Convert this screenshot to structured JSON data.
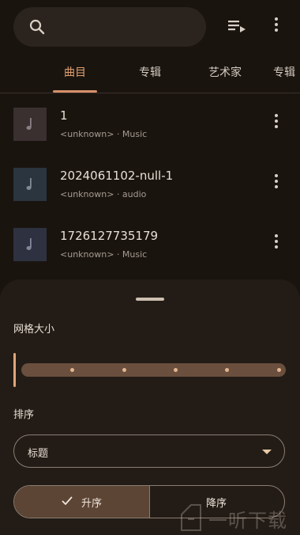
{
  "tabs": [
    {
      "label": "曲目"
    },
    {
      "label": "专辑"
    },
    {
      "label": "艺术家"
    },
    {
      "label": "专辑"
    }
  ],
  "songs": [
    {
      "title": "1",
      "subtitle": "<unknown> · Music",
      "thumb_color": "#3a3030"
    },
    {
      "title": "2024061102-null-1",
      "subtitle": "<unknown> · audio",
      "thumb_color": "#2a3540"
    },
    {
      "title": "1726127735179",
      "subtitle": "<unknown> · Music",
      "thumb_color": "#2e3140"
    }
  ],
  "sheet": {
    "grid_size_label": "网格大小",
    "grid_size_value": 0,
    "grid_size_steps": 6,
    "sort_label": "排序",
    "sort_value": "标题",
    "ascending_label": "升序",
    "descending_label": "降序",
    "selected_order": "ascending"
  },
  "watermark": {
    "text": "一听下载"
  },
  "colors": {
    "background": "#1a140f",
    "accent": "#e3a06e",
    "sheet": "#231c16",
    "selected_segment": "#5c4535"
  }
}
